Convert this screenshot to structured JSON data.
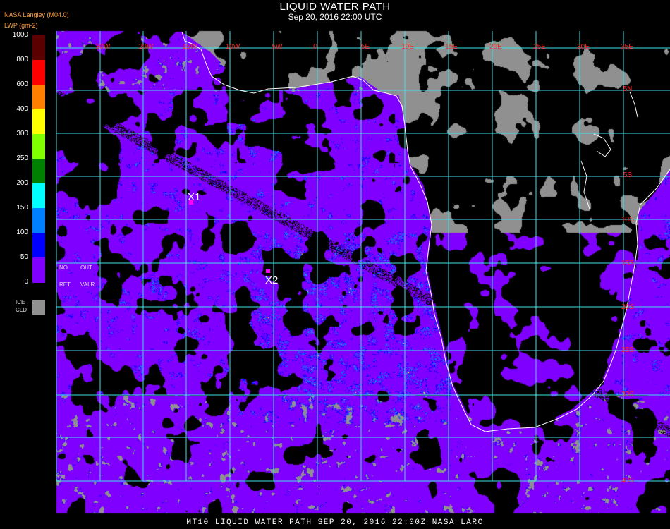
{
  "header": {
    "title": "LIQUID WATER PATH",
    "subtitle": "Sep 20, 2016 22:00 UTC",
    "producer": "NASA Langley (M04.0)",
    "units": "LWP (gm-2)"
  },
  "legend": {
    "ticks": [
      "1000",
      "800",
      "600",
      "400",
      "300",
      "250",
      "200",
      "150",
      "100",
      "50",
      "0"
    ],
    "colors": [
      "#5a0000",
      "#ff0000",
      "#ff8000",
      "#ffff00",
      "#80ff00",
      "#008000",
      "#00ffff",
      "#0080ff",
      "#0000ff",
      "#8000ff"
    ],
    "notes": {
      "no": "NO",
      "out": "OUT",
      "ret": "RET",
      "valr": "VALR",
      "ice": "ICE",
      "cld": "CLD"
    },
    "ice_color": "#909090"
  },
  "map": {
    "lon_labels": [
      "30W",
      "20W",
      "15W",
      "10W",
      "5W",
      "0",
      "5E",
      "10E",
      "15E",
      "20E",
      "25E",
      "30E",
      "35E"
    ],
    "lat_labels": [
      "5N",
      "5S",
      "10S",
      "15S",
      "20S",
      "25S",
      "30S",
      "40S"
    ],
    "grid_color": "#40e0e8",
    "coast_color": "#ffffff",
    "markers": [
      {
        "label": "X1",
        "color": "#ff00ff"
      },
      {
        "label": "X2",
        "color": "#ff00ff"
      }
    ],
    "cloud_colors": {
      "low_lwp": "#8000ff",
      "mid_lwp": "#0000ff",
      "higher_lwp": "#0080ff",
      "ice": "#909090",
      "clear": "#000000"
    }
  },
  "footer": "MT10  LIQUID WATER PATH   SEP 20, 2016 22:00Z   NASA LARC"
}
